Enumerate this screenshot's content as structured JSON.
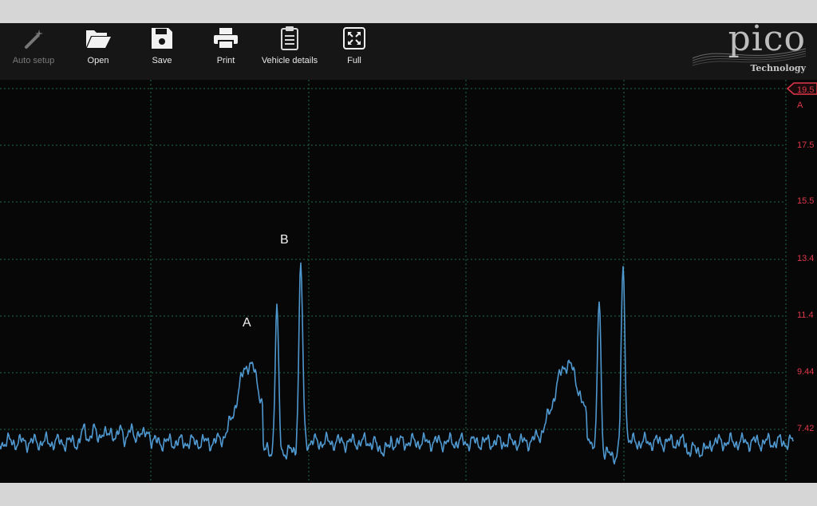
{
  "toolbar": {
    "items": [
      {
        "label": "Auto setup",
        "icon": "magic-wand-icon",
        "enabled": false
      },
      {
        "label": "Open",
        "icon": "folder-open-icon",
        "enabled": true
      },
      {
        "label": "Save",
        "icon": "floppy-disk-icon",
        "enabled": true
      },
      {
        "label": "Print",
        "icon": "printer-icon",
        "enabled": true
      },
      {
        "label": "Vehicle details",
        "icon": "clipboard-icon",
        "enabled": true
      },
      {
        "label": "Full",
        "icon": "fullscreen-icon",
        "enabled": true
      }
    ]
  },
  "brand": {
    "name": "pico",
    "subtitle": "Technology"
  },
  "scale": {
    "channel": "A",
    "top_label": "19.5",
    "ticks": [
      "17.5",
      "15.5",
      "13.4",
      "11.4",
      "9.44",
      "7.42"
    ],
    "color": "#e0384a"
  },
  "annotations": {
    "a": "A",
    "b": "B"
  },
  "colors": {
    "trace": "#4f98cf",
    "grid": "#1f6b4a",
    "background": "#070707"
  }
}
